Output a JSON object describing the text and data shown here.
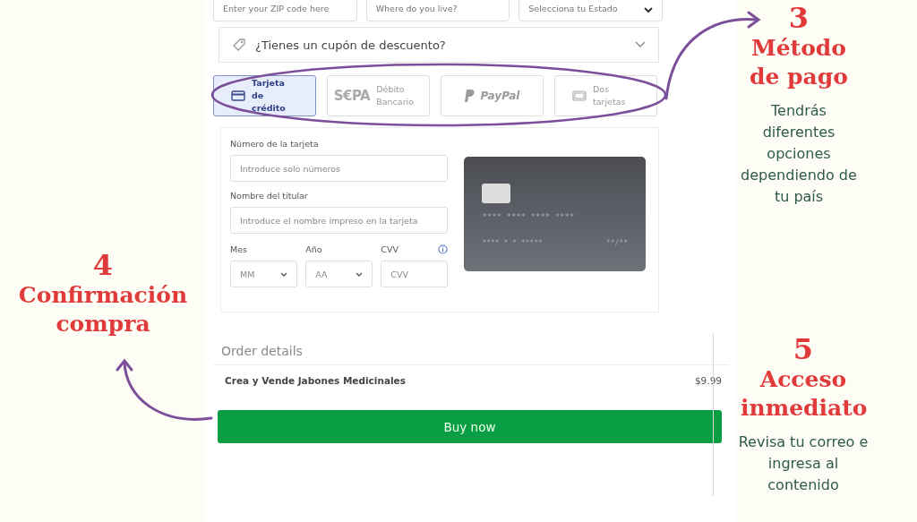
{
  "address_fields": [
    {
      "kind": "input",
      "placeholder": "Enter your ZIP code here"
    },
    {
      "kind": "input",
      "placeholder": "Where do you live?"
    },
    {
      "kind": "select",
      "placeholder": "Selecciona tu Estado"
    }
  ],
  "coupon": {
    "label": "¿Tienes un cupón de descuento?",
    "expanded": false
  },
  "payment_methods": [
    {
      "kind": "card",
      "label": "Tarjeta de crédito",
      "selected": true
    },
    {
      "kind": "sepa",
      "logo": "S€PA",
      "label": "Débito Bancario",
      "selected": false
    },
    {
      "kind": "paypal",
      "label": "PayPal",
      "selected": false
    },
    {
      "kind": "two_cards",
      "label": "Dos tarjetas",
      "selected": false
    }
  ],
  "card_form": {
    "number_label": "Número de la tarjeta",
    "number_placeholder": "Introduce solo números",
    "holder_label": "Nombre del titular",
    "holder_placeholder": "Introduce el nombre impreso en la tarjeta",
    "month_label": "Mes",
    "month_placeholder": "MM",
    "year_label": "Año",
    "year_placeholder": "AA",
    "cvv_label": "CVV",
    "cvv_placeholder": "CVV"
  },
  "card_preview": {
    "number": "**** **** **** ****",
    "line_2": "**** * * *****",
    "expiry": "**/**"
  },
  "order": {
    "title": "Order details",
    "items": [
      {
        "name": "Crea y Vende Jabones Medicinales",
        "price": "$9.99"
      }
    ],
    "button": "Buy now"
  },
  "annotations": [
    {
      "number": "3",
      "title": "Método de pago",
      "text": "Tendrás diferentes opciones dependiendo de tu país"
    },
    {
      "number": "4",
      "title": "Confirmación compra"
    },
    {
      "number": "5",
      "title": "Acceso inmediato",
      "text": "Revisa tu correo e ingresa al contenido"
    }
  ]
}
